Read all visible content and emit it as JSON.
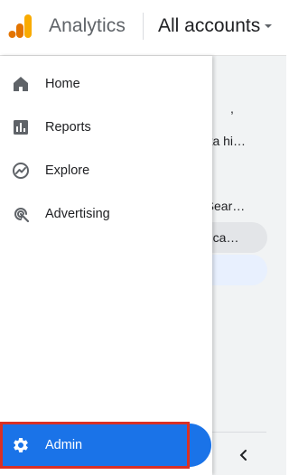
{
  "header": {
    "app_name": "Analytics",
    "account_label": "All accounts"
  },
  "nav": {
    "items": [
      {
        "label": "Home",
        "icon": "home-icon"
      },
      {
        "label": "Reports",
        "icon": "reports-icon"
      },
      {
        "label": "Explore",
        "icon": "explore-icon"
      },
      {
        "label": "Advertising",
        "icon": "advertising-icon"
      }
    ],
    "admin": {
      "label": "Admin",
      "icon": "gear-icon"
    }
  },
  "background": {
    "text_1": "uota hi…",
    "text_2": "e Sear…",
    "chip_text": "odifica…"
  },
  "colors": {
    "accent": "#1a73e8",
    "highlight": "#d93025",
    "logo_orange": "#f9ab00",
    "logo_dark_orange": "#e37400"
  }
}
